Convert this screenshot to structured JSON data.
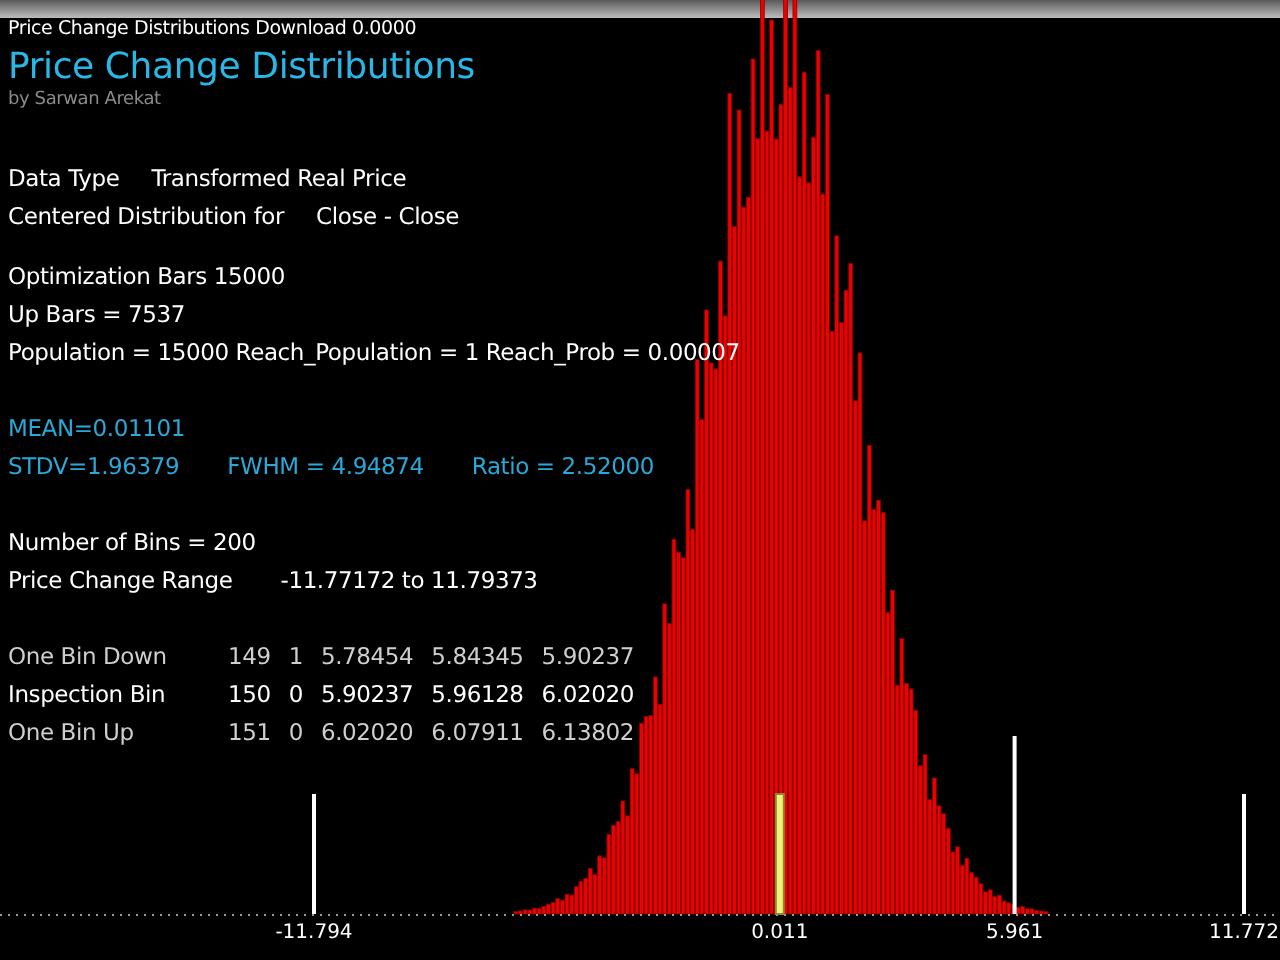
{
  "window": {
    "title": "Price Change Distributions Download 0.0000"
  },
  "heading": {
    "title": "Price Change Distributions",
    "author": "by Sarwan Arekat"
  },
  "data_type": {
    "label": "Data Type",
    "value": "Transformed Real Price"
  },
  "distribution": {
    "label": "Centered Distribution for",
    "value": "Close - Close"
  },
  "bars_info": [
    "Optimization Bars  15000",
    "Up Bars = 7537",
    "Population = 15000  Reach_Population = 1  Reach_Prob = 0.00007"
  ],
  "mean": "MEAN=0.01101",
  "spread": [
    "STDV=1.96379",
    "FWHM = 4.94874",
    "Ratio = 2.52000"
  ],
  "bins": {
    "count": "Number of Bins = 200",
    "range_label": "Price Change Range",
    "range_value": "-11.77172  to  11.79373"
  },
  "bin_rows": [
    {
      "label": "One Bin Down",
      "highlighted": false,
      "cells": [
        "149",
        "1",
        "5.78454",
        "5.84345",
        "5.90237"
      ]
    },
    {
      "label": "Inspection Bin",
      "highlighted": true,
      "cells": [
        "150",
        "0",
        "5.90237",
        "5.96128",
        "6.02020"
      ]
    },
    {
      "label": "One Bin Up",
      "highlighted": false,
      "cells": [
        "151",
        "0",
        "6.02020",
        "6.07911",
        "6.13802"
      ]
    }
  ],
  "axis_markers": [
    {
      "label": "-11.794",
      "kind": "limit"
    },
    {
      "label": "0.011",
      "kind": "mean"
    },
    {
      "label": "5.961",
      "kind": "inspection"
    },
    {
      "label": "11.772",
      "kind": "limit"
    }
  ]
}
